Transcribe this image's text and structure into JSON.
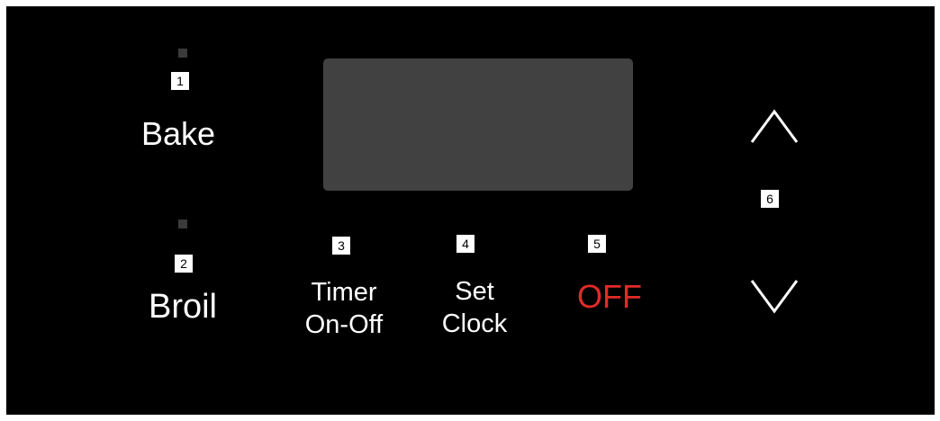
{
  "buttons": {
    "bake": {
      "number": "1",
      "label": "Bake"
    },
    "broil": {
      "number": "2",
      "label": "Broil"
    },
    "timer": {
      "number": "3",
      "line1": "Timer",
      "line2": "On-Off"
    },
    "set_clock": {
      "number": "4",
      "line1": "Set",
      "line2": "Clock"
    },
    "off": {
      "number": "5",
      "label": "OFF"
    },
    "arrows": {
      "number": "6",
      "up_icon": "chevron-up-icon",
      "down_icon": "chevron-down-icon"
    }
  },
  "colors": {
    "panel": "#000000",
    "display": "#414141",
    "indicator": "#3a3a3a",
    "text": "#ffffff",
    "off_text": "#e32a28"
  }
}
